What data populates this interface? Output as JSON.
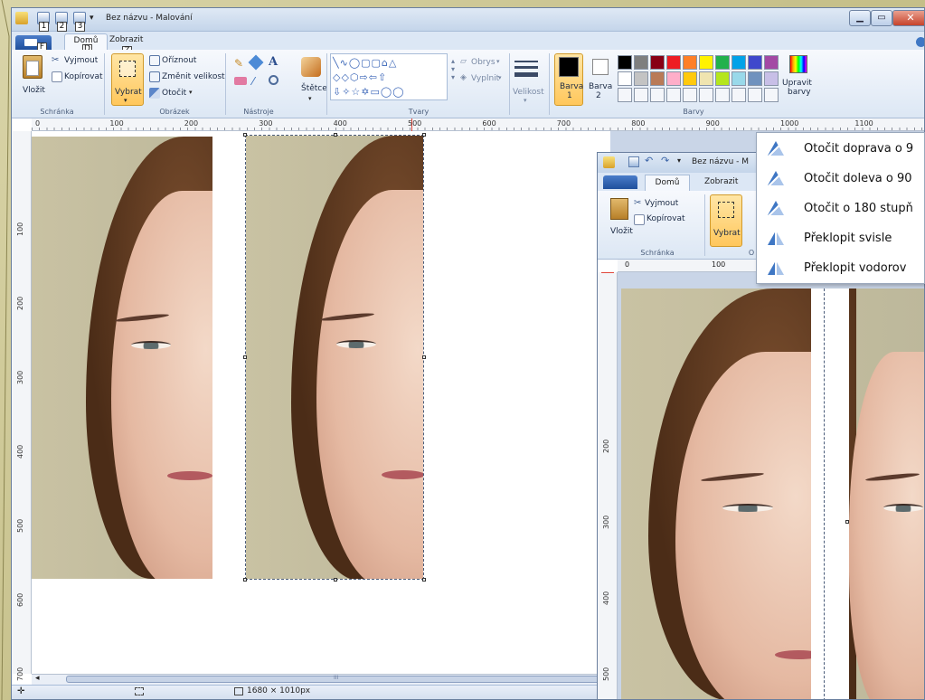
{
  "window": {
    "title": "Bez názvu - Malování",
    "qat_keys": [
      "1",
      "2",
      "3"
    ]
  },
  "tabs": {
    "file_key": "F",
    "home": "Domů",
    "home_key": "D",
    "view": "Zobrazit",
    "view_key": "Z"
  },
  "ribbon": {
    "clipboard": {
      "paste": "Vložit",
      "cut": "Vyjmout",
      "copy": "Kopírovat",
      "label": "Schránka"
    },
    "image": {
      "select": "Vybrat",
      "crop": "Oříznout",
      "resize": "Změnit velikost",
      "rotate": "Otočit",
      "label": "Obrázek"
    },
    "tools": {
      "label": "Nástroje"
    },
    "brushes": "Štětce",
    "shapes": {
      "outline": "Obrys",
      "fill": "Vyplnit",
      "label": "Tvary"
    },
    "size": "Velikost",
    "color1": "Barva\n1",
    "color1_line1": "Barva",
    "color1_line2": "1",
    "color2_line1": "Barva",
    "color2_line2": "2",
    "edit_colors_line1": "Upravit",
    "edit_colors_line2": "barvy",
    "colors_label": "Barvy",
    "palette": [
      "#000000",
      "#7f7f7f",
      "#880015",
      "#ed1c24",
      "#ff7f27",
      "#fff200",
      "#22b14c",
      "#00a2e8",
      "#3f48cc",
      "#a349a4",
      "#ffffff",
      "#c3c3c3",
      "#b97a57",
      "#ffaec9",
      "#ffc90e",
      "#efe4b0",
      "#b5e61d",
      "#99d9ea",
      "#7092be",
      "#c8bfe7"
    ]
  },
  "ruler": {
    "h": [
      "0",
      "100",
      "200",
      "300",
      "400",
      "500",
      "600",
      "700",
      "800",
      "900",
      "1000",
      "1100"
    ],
    "v": [
      "100",
      "200",
      "300",
      "400",
      "500",
      "600",
      "700"
    ]
  },
  "status": {
    "size": "1680 × 1010px"
  },
  "window2": {
    "title": "Bez názvu - M",
    "home": "Domů",
    "view": "Zobrazit",
    "paste": "Vložit",
    "cut": "Vyjmout",
    "copy": "Kopírovat",
    "select": "Vybrat",
    "clipboard_label": "Schránka",
    "group_letter": "O",
    "ruler_h": [
      "0",
      "100"
    ],
    "ruler_v": [
      "200",
      "300",
      "400",
      "500"
    ]
  },
  "rotate_menu": {
    "items": [
      {
        "label": "Otočit doprava o 9"
      },
      {
        "label": "Otočit doleva o 90"
      },
      {
        "label": "Otočit o 180 stupň"
      },
      {
        "label": "Překlopit svisle"
      },
      {
        "label": "Překlopit vodorov"
      }
    ]
  },
  "icons": {
    "app": "paint-app-icon",
    "scroll_left": "◂",
    "scroll_center": "III"
  },
  "colors": {
    "accent": "#ffc75c",
    "ribbon": "#dce7f4",
    "close": "#c7432b"
  }
}
